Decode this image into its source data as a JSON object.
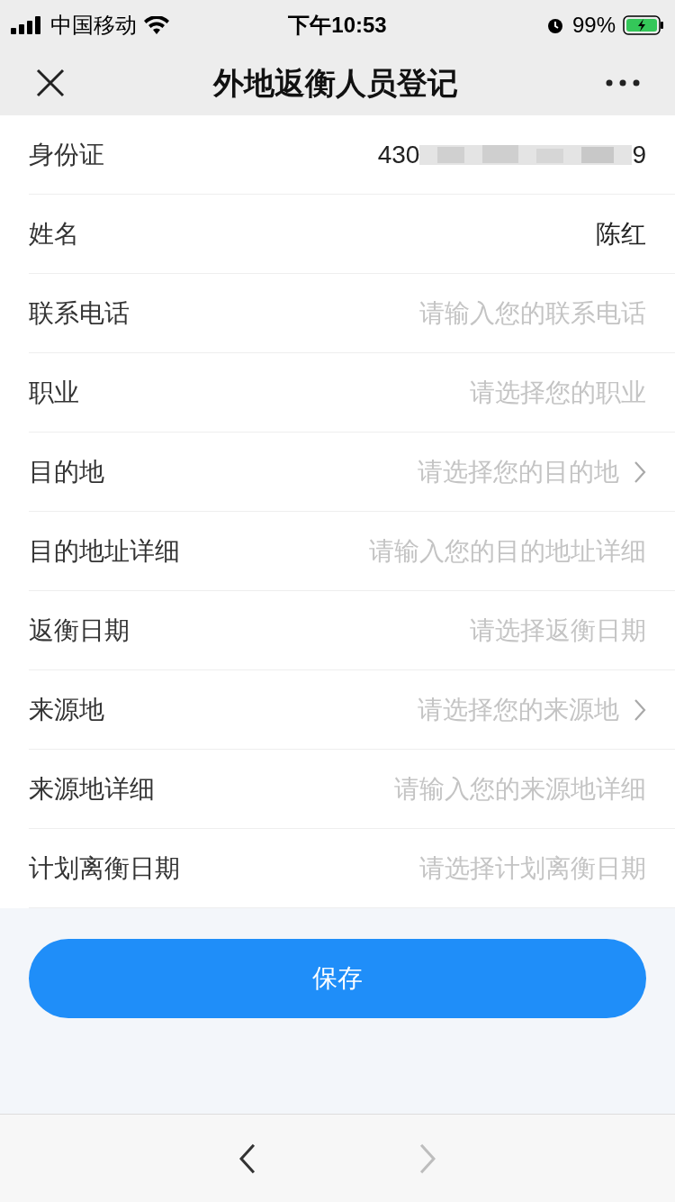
{
  "status_bar": {
    "carrier": "中国移动",
    "time": "下午10:53",
    "battery": "99%"
  },
  "nav": {
    "title": "外地返衡人员登记"
  },
  "rows": [
    {
      "kind": "masked",
      "label": "身份证",
      "value_start": "430",
      "value_end": "9"
    },
    {
      "kind": "value",
      "label": "姓名",
      "value": "陈红"
    },
    {
      "kind": "input",
      "label": "联系电话",
      "placeholder": "请输入您的联系电话"
    },
    {
      "kind": "select",
      "label": "职业",
      "placeholder": "请选择您的职业",
      "chevron": false
    },
    {
      "kind": "select",
      "label": "目的地",
      "placeholder": "请选择您的目的地",
      "chevron": true
    },
    {
      "kind": "input",
      "label": "目的地址详细",
      "placeholder": "请输入您的目的地址详细"
    },
    {
      "kind": "select",
      "label": "返衡日期",
      "placeholder": "请选择返衡日期",
      "chevron": false
    },
    {
      "kind": "select",
      "label": "来源地",
      "placeholder": "请选择您的来源地",
      "chevron": true
    },
    {
      "kind": "input",
      "label": "来源地详细",
      "placeholder": "请输入您的来源地详细"
    },
    {
      "kind": "select",
      "label": "计划离衡日期",
      "placeholder": "请选择计划离衡日期",
      "chevron": false
    }
  ],
  "save_button": "保存",
  "toolbar": {
    "back": {
      "disabled": false
    },
    "forward": {
      "disabled": true
    }
  }
}
